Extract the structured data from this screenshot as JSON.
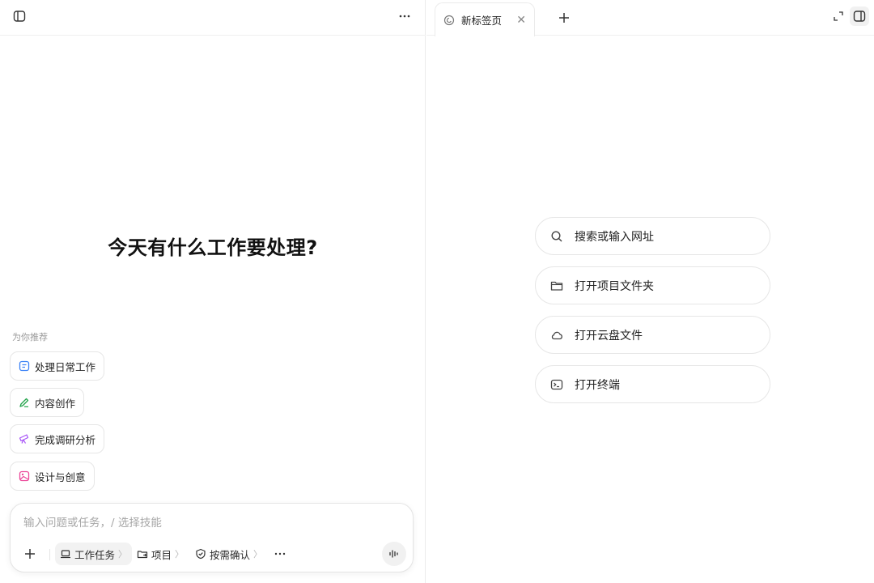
{
  "left": {
    "heading": "今天有什么工作要处理?",
    "recommend_title": "为你推荐",
    "chips": [
      {
        "label": "处理日常工作",
        "icon": "list-doc-icon",
        "color": "#3b82f6"
      },
      {
        "label": "内容创作",
        "icon": "pen-icon",
        "color": "#22a34a"
      },
      {
        "label": "完成调研分析",
        "icon": "telescope-icon",
        "color": "#a855f7"
      },
      {
        "label": "设计与创意",
        "icon": "image-icon",
        "color": "#ec4899"
      }
    ],
    "composer": {
      "placeholder": "输入问题或任务，/ 选择技能",
      "tool_work": "工作任务",
      "tool_project": "项目",
      "tool_confirm": "按需确认",
      "chevron": "〉"
    }
  },
  "right": {
    "tab_title": "新标签页",
    "actions": [
      {
        "label": "搜索或输入网址",
        "icon": "search-icon"
      },
      {
        "label": "打开项目文件夹",
        "icon": "folder-icon"
      },
      {
        "label": "打开云盘文件",
        "icon": "cloud-icon"
      },
      {
        "label": "打开终端",
        "icon": "terminal-icon"
      }
    ]
  }
}
